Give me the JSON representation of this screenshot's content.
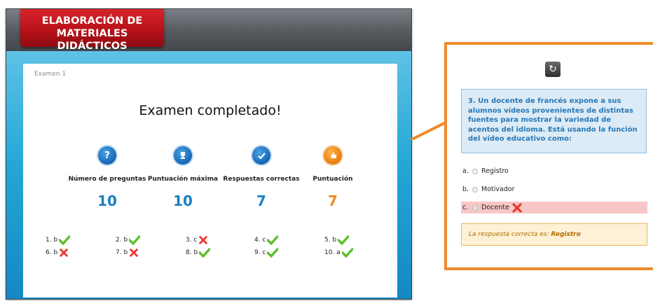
{
  "app": {
    "logo_line1": "ELABORACIÓN DE",
    "logo_line2": "MATERIALES DIDÁCTICOS"
  },
  "exam": {
    "label": "Examen 1",
    "heading": "Examen completado!",
    "stats": [
      {
        "icon": "question-mark-icon",
        "label": "Número de preguntas",
        "value": "10",
        "color": "#1a7fc1"
      },
      {
        "icon": "trophy-icon",
        "label": "Puntuación máxima",
        "value": "10",
        "color": "#1a7fc1"
      },
      {
        "icon": "checkmark-icon",
        "label": "Respuestas correctas",
        "value": "7",
        "color": "#1a7fc1"
      },
      {
        "icon": "hand-pointer-icon",
        "label": "Puntuación",
        "value": "7",
        "color": "#f08a1d"
      }
    ],
    "answers": [
      {
        "text": "1. b",
        "result": "correct"
      },
      {
        "text": "2. b",
        "result": "correct"
      },
      {
        "text": "3. c",
        "result": "wrong"
      },
      {
        "text": "4. c",
        "result": "correct"
      },
      {
        "text": "5. b",
        "result": "correct"
      },
      {
        "text": "6. b",
        "result": "wrong"
      },
      {
        "text": "7. b",
        "result": "wrong"
      },
      {
        "text": "8. b",
        "result": "correct"
      },
      {
        "text": "9. c",
        "result": "correct"
      },
      {
        "text": "10. a",
        "result": "correct"
      }
    ]
  },
  "detail": {
    "question": "3. Un docente de francés expone a sus alumnos vídeos provenientes de distintas fuentes para mostrar la variedad de acentos del idioma. Está usando la función del vídeo educativo como:",
    "options": [
      {
        "letter": "a.",
        "label": "Registro",
        "selected": false
      },
      {
        "letter": "b.",
        "label": "Motivador",
        "selected": false
      },
      {
        "letter": "c.",
        "label": "Docente",
        "selected": true,
        "wrong": true
      }
    ],
    "feedback_prefix": "La respuesta correcta es:",
    "feedback_answer": "Registro"
  },
  "colors": {
    "accent_orange": "#f08a2a",
    "stage_blue": "#24a7d7",
    "logo_red": "#c4161d",
    "correct_green": "#5cbf2a",
    "wrong_red": "#e8392b"
  }
}
